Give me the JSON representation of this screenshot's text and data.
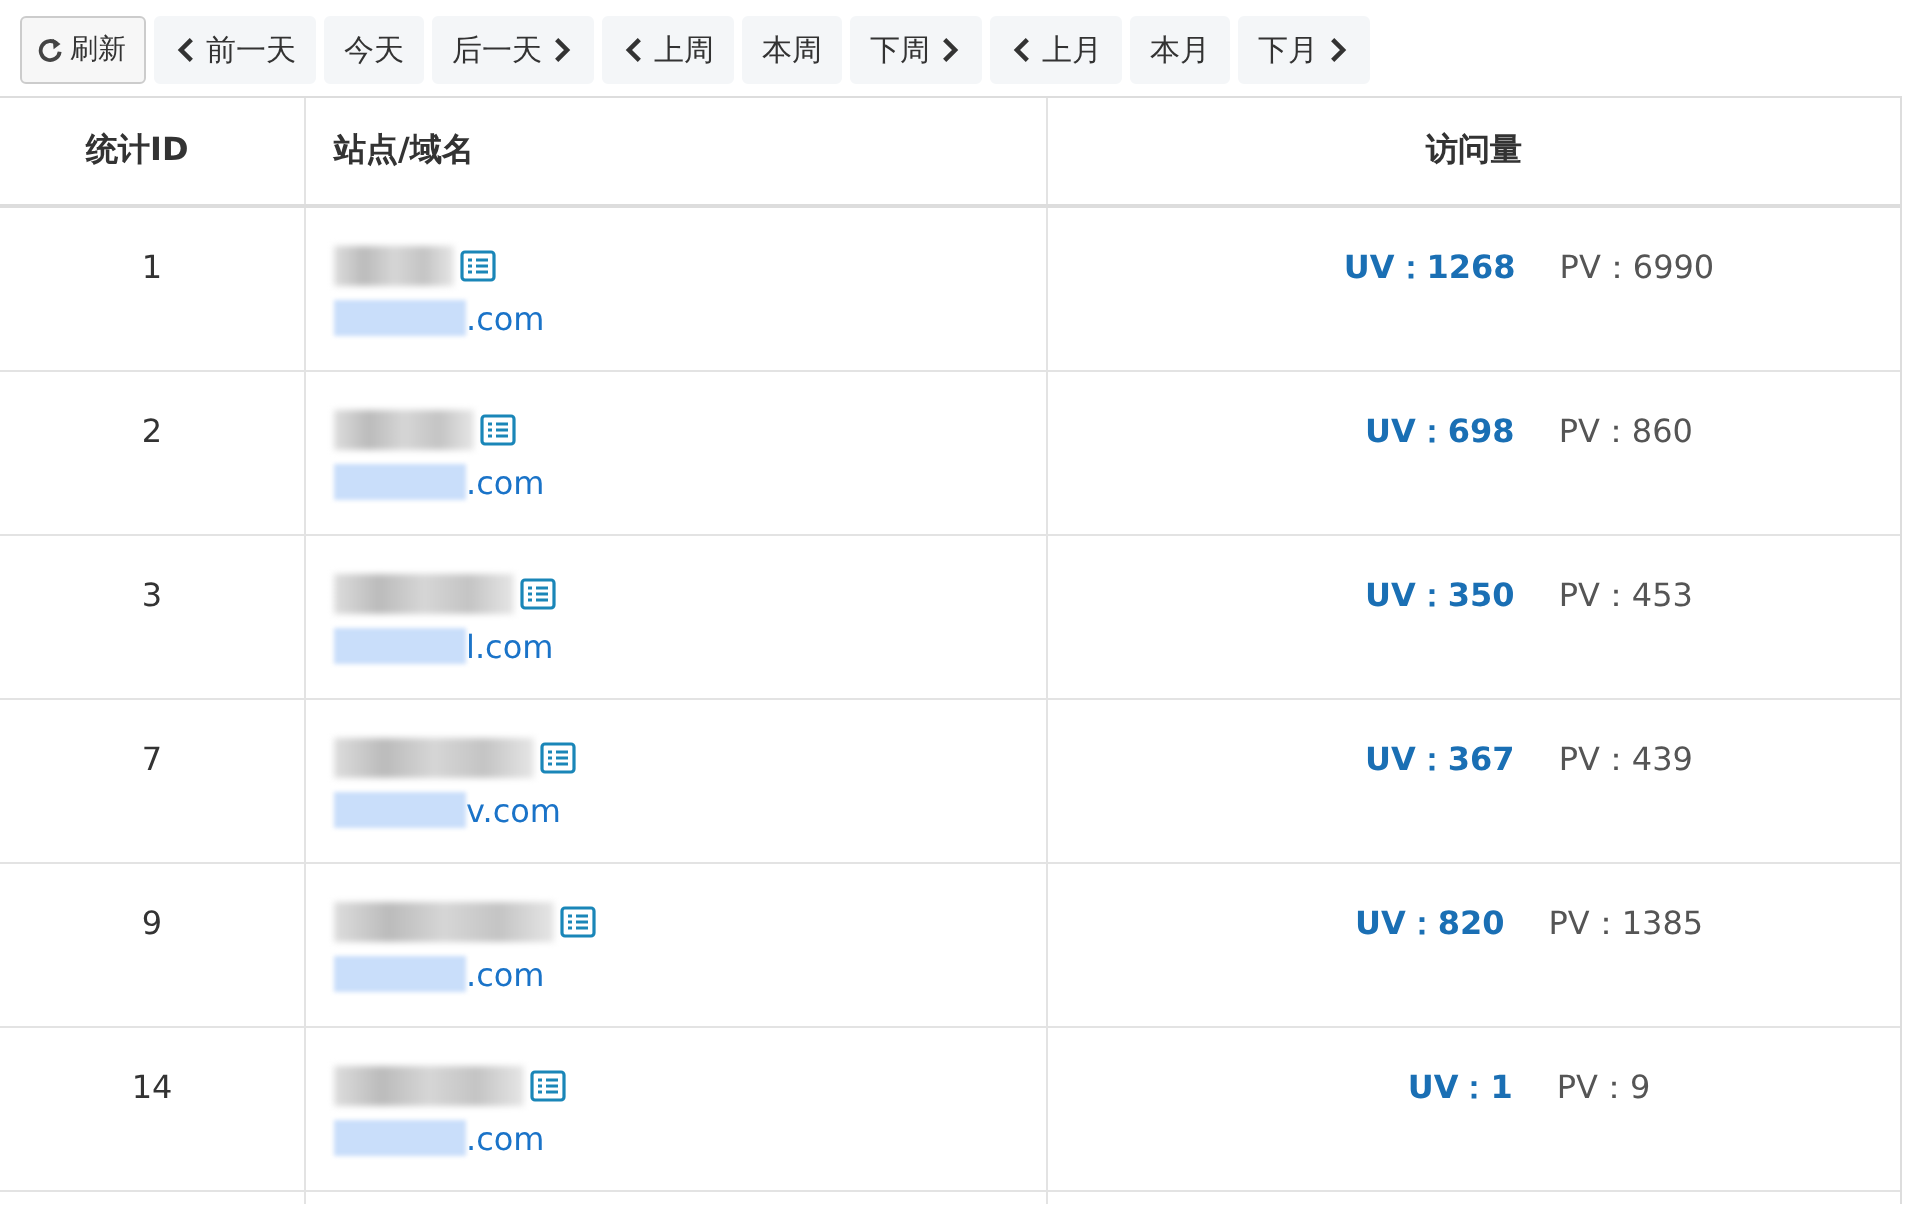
{
  "toolbar": [
    {
      "kind": "refresh",
      "label": "刷新"
    },
    {
      "kind": "prev",
      "label": "前一天"
    },
    {
      "kind": "plain",
      "label": "今天"
    },
    {
      "kind": "next",
      "label": "后一天"
    },
    {
      "kind": "prev",
      "label": "上周"
    },
    {
      "kind": "plain",
      "label": "本周"
    },
    {
      "kind": "next",
      "label": "下周"
    },
    {
      "kind": "prev",
      "label": "上月"
    },
    {
      "kind": "plain",
      "label": "本月"
    },
    {
      "kind": "next",
      "label": "下月"
    }
  ],
  "table": {
    "columns": [
      "统计ID",
      "站点/域名",
      "访问量"
    ],
    "rows": [
      {
        "id": "1",
        "domain": ".com",
        "uv": "UV：1268",
        "pv": "PV：6990"
      },
      {
        "id": "2",
        "domain": ".com",
        "uv": "UV：698",
        "pv": "PV：860"
      },
      {
        "id": "3",
        "domain": "l.com",
        "uv": "UV：350",
        "pv": "PV：453"
      },
      {
        "id": "7",
        "domain": "v.com",
        "uv": "UV：367",
        "pv": "PV：439"
      },
      {
        "id": "9",
        "domain": ".com",
        "uv": "UV：820",
        "pv": "PV：1385"
      },
      {
        "id": "14",
        "domain": ".com",
        "uv": "UV：1",
        "pv": "PV：9"
      }
    ]
  }
}
